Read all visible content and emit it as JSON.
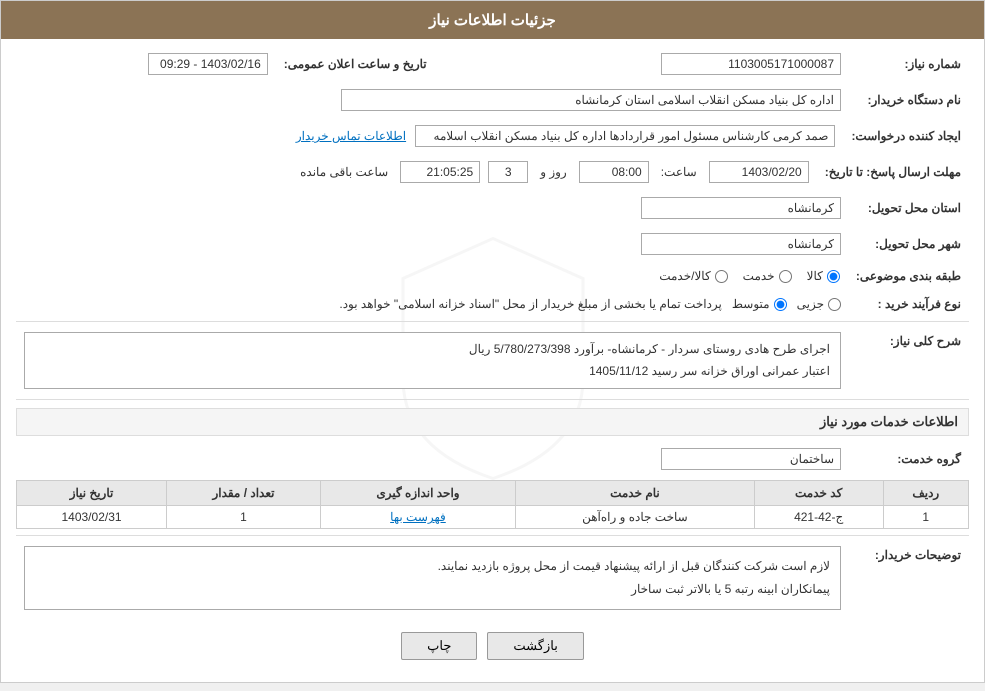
{
  "header": {
    "title": "جزئیات اطلاعات نیاز"
  },
  "fields": {
    "shomareNiaz_label": "شماره نیاز:",
    "shomareNiaz_value": "1103005171000087",
    "namDastgah_label": "نام دستگاه خریدار:",
    "namDastgah_value": "اداره کل بنیاد مسکن انقلاب اسلامی استان کرمانشاه",
    "ijadKonande_label": "ایجاد کننده درخواست:",
    "ijadKonande_value": "صمد کرمی کارشناس مسئول امور قراردادها اداره کل بنیاد مسکن انقلاب اسلامه",
    "ijadKonande_link": "اطلاعات تماس خریدار",
    "mohlat_label": "مهلت ارسال پاسخ: تا تاریخ:",
    "tarikhe_date": "1403/02/20",
    "saate_label": "ساعت:",
    "saate_value": "08:00",
    "rooz_label": "روز و",
    "rooz_value": "3",
    "baghimande_label": "ساعت باقی مانده",
    "baghimande_value": "21:05:25",
    "tarikh_label": "تاریخ و ساعت اعلان عمومی:",
    "tarikh_value": "1403/02/16 - 09:29",
    "ostan_label": "استان محل تحویل:",
    "ostan_value": "کرمانشاه",
    "shahr_label": "شهر محل تحویل:",
    "shahr_value": "کرمانشاه",
    "tabaqe_label": "طبقه بندی موضوعی:",
    "tabaqe_radio1": "کالا",
    "tabaqe_radio2": "خدمت",
    "tabaqe_radio3": "کالا/خدمت",
    "tabaqe_selected": "کالا",
    "noeFarayand_label": "نوع فرآیند خرید :",
    "noeFarayand_radio1": "جزیی",
    "noeFarayand_radio2": "متوسط",
    "noeFarayand_note": "پرداخت تمام یا بخشی از مبلغ خریدار از محل \"اسناد خزانه اسلامی\" خواهد بود.",
    "noeFarayand_selected": "متوسط"
  },
  "sharh": {
    "title": "شرح کلی نیاز:",
    "text1": "اجرای طرح هادی روستای سردار - کرمانشاه- برآورد 5/780/273/398 ریال",
    "text2": "اعتبار عمرانی اوراق خزانه سر رسید 1405/11/12"
  },
  "khadamat": {
    "section_title": "اطلاعات خدمات مورد نیاز",
    "grouh_label": "گروه خدمت:",
    "grouh_value": "ساختمان",
    "table": {
      "headers": [
        "ردیف",
        "کد خدمت",
        "نام خدمت",
        "واحد اندازه گیری",
        "تعداد / مقدار",
        "تاریخ نیاز"
      ],
      "rows": [
        {
          "radif": "1",
          "kod": "ج-42-421",
          "nam": "ساخت جاده و راه‌آهن",
          "vahed": "فهرست بها",
          "tedad": "1",
          "tarikh": "1403/02/31"
        }
      ]
    }
  },
  "toseeh": {
    "label": "توضیحات خریدار:",
    "line1": "لازم است شرکت کنندگان قبل از ارائه پیشنهاد قیمت از محل پروژه بازدید نمایند.",
    "line2": "پیمانکاران ابینه رتبه 5 یا بالاتر ثبت ساخار"
  },
  "buttons": {
    "print": "چاپ",
    "back": "بازگشت"
  }
}
